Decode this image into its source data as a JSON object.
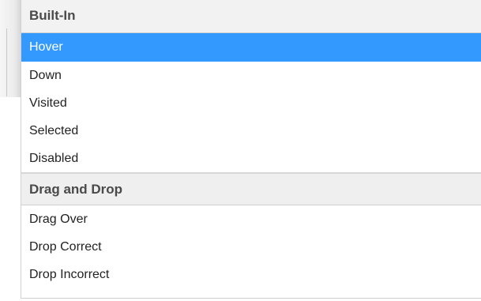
{
  "dropdown": {
    "groups": [
      {
        "label": "Built-In",
        "options": [
          "Hover",
          "Down",
          "Visited",
          "Selected",
          "Disabled"
        ]
      },
      {
        "label": "Drag and Drop",
        "options": [
          "Drag Over",
          "Drop Correct",
          "Drop Incorrect"
        ]
      }
    ],
    "highlighted_option": "Hover",
    "highlight_color": "#3399ff",
    "header_color": "#efefef"
  }
}
